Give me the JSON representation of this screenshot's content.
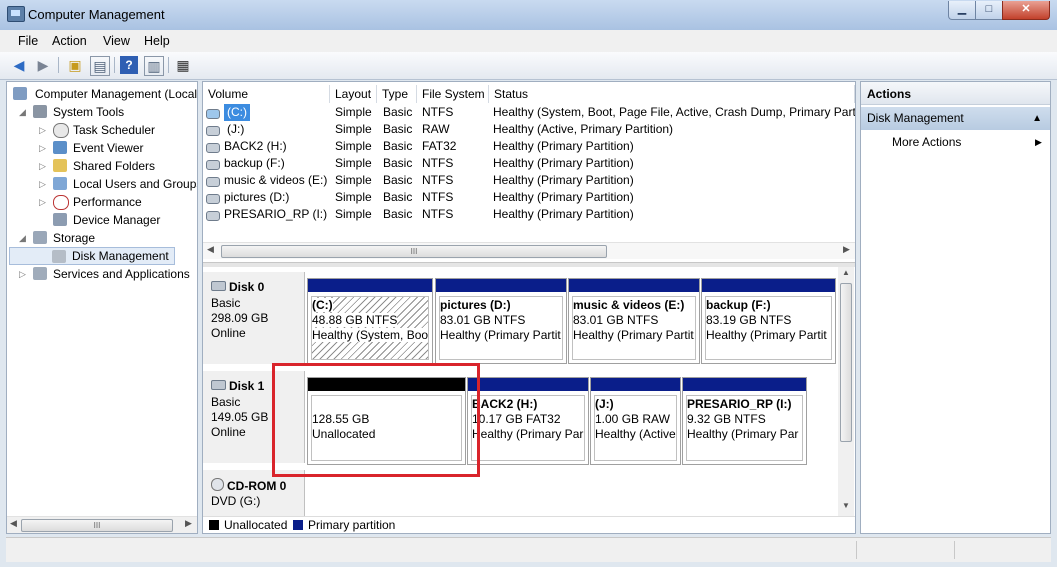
{
  "window": {
    "title": "Computer Management"
  },
  "menu": [
    "File",
    "Action",
    "View",
    "Help"
  ],
  "tree": [
    {
      "label": "Computer Management (Local",
      "level": 0
    },
    {
      "label": "System Tools",
      "level": 1
    },
    {
      "label": "Task Scheduler",
      "level": 2
    },
    {
      "label": "Event Viewer",
      "level": 2
    },
    {
      "label": "Shared Folders",
      "level": 2
    },
    {
      "label": "Local Users and Groups",
      "level": 2
    },
    {
      "label": "Performance",
      "level": 2
    },
    {
      "label": "Device Manager",
      "level": 2
    },
    {
      "label": "Storage",
      "level": 1
    },
    {
      "label": "Disk Management",
      "level": 2
    },
    {
      "label": "Services and Applications",
      "level": 1
    }
  ],
  "volume_table": {
    "headers": [
      "Volume",
      "Layout",
      "Type",
      "File System",
      "Status"
    ],
    "rows": [
      [
        "(C:)",
        "Simple",
        "Basic",
        "NTFS",
        "Healthy (System, Boot, Page File, Active, Crash Dump, Primary Partiti"
      ],
      [
        "(J:)",
        "Simple",
        "Basic",
        "RAW",
        "Healthy (Active, Primary Partition)"
      ],
      [
        "BACK2 (H:)",
        "Simple",
        "Basic",
        "FAT32",
        "Healthy (Primary Partition)"
      ],
      [
        "backup (F:)",
        "Simple",
        "Basic",
        "NTFS",
        "Healthy (Primary Partition)"
      ],
      [
        "music & videos (E:)",
        "Simple",
        "Basic",
        "NTFS",
        "Healthy (Primary Partition)"
      ],
      [
        "pictures (D:)",
        "Simple",
        "Basic",
        "NTFS",
        "Healthy (Primary Partition)"
      ],
      [
        "PRESARIO_RP (I:)",
        "Simple",
        "Basic",
        "NTFS",
        "Healthy (Primary Partition)"
      ]
    ]
  },
  "disks": [
    {
      "name": "Disk 0",
      "type": "Basic",
      "size": "298.09 GB",
      "status": "Online",
      "partitions": [
        {
          "name": "(C:)",
          "size": "48.88 GB NTFS",
          "status": "Healthy (System, Boo"
        },
        {
          "name": "pictures  (D:)",
          "size": "83.01 GB NTFS",
          "status": "Healthy (Primary Partit"
        },
        {
          "name": "music & videos  (E:)",
          "size": "83.01 GB NTFS",
          "status": "Healthy (Primary Partit"
        },
        {
          "name": "backup  (F:)",
          "size": "83.19 GB NTFS",
          "status": "Healthy (Primary Partit"
        }
      ]
    },
    {
      "name": "Disk 1",
      "type": "Basic",
      "size": "149.05 GB",
      "status": "Online",
      "partitions": [
        {
          "name": "",
          "size": "128.55 GB",
          "status": "Unallocated"
        },
        {
          "name": "BACK2  (H:)",
          "size": "10.17 GB FAT32",
          "status": "Healthy (Primary Par"
        },
        {
          "name": "(J:)",
          "size": "1.00 GB RAW",
          "status": "Healthy (Active"
        },
        {
          "name": "PRESARIO_RP  (I:)",
          "size": "9.32 GB NTFS",
          "status": "Healthy (Primary Par"
        }
      ]
    },
    {
      "name": "CD-ROM 0",
      "type": "DVD (G:)"
    }
  ],
  "legend": [
    {
      "label": "Unallocated",
      "color": "#000000"
    },
    {
      "label": "Primary partition",
      "color": "#0a1e8a"
    }
  ],
  "actions": {
    "title": "Actions",
    "section": "Disk Management",
    "items": [
      "More Actions"
    ]
  },
  "colors": {
    "primary_partition": "#0a1e8a",
    "unallocated": "#000000",
    "highlight": "#d9242b"
  }
}
